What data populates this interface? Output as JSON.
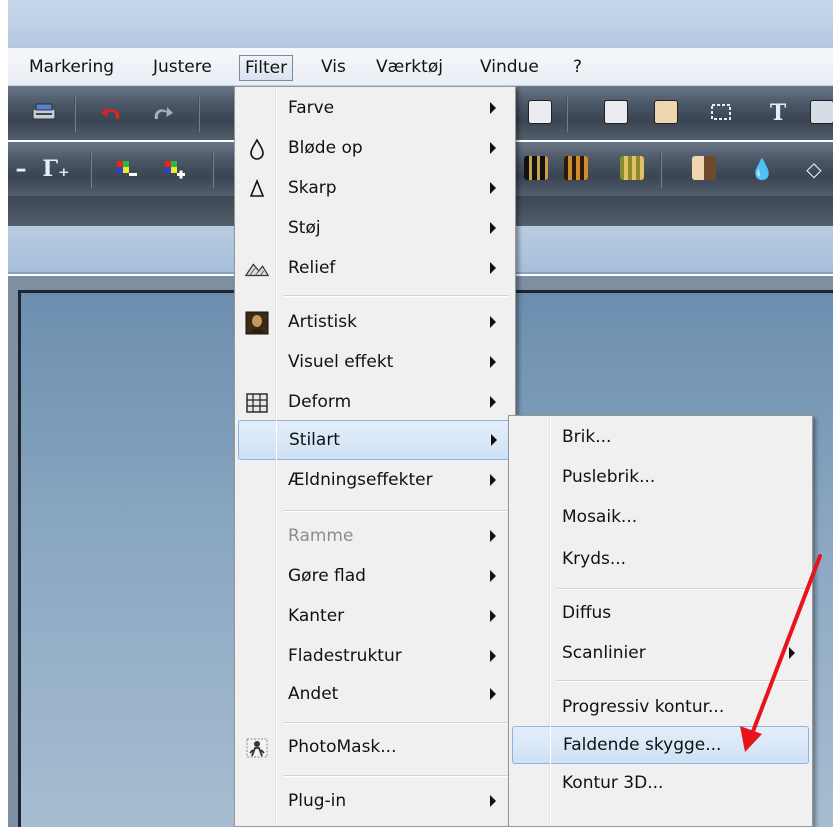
{
  "menubar": {
    "items": [
      "Markering",
      "Justere",
      "Filter",
      "Vis",
      "Værktøj",
      "Vindue",
      "?"
    ]
  },
  "filter_menu": {
    "items": [
      {
        "label": "Farve",
        "icon": "",
        "submenu": true
      },
      {
        "label": "Bløde op",
        "icon": "drop-outline-icon",
        "submenu": true
      },
      {
        "label": "Skarp",
        "icon": "triangle-outline-icon",
        "submenu": true
      },
      {
        "label": "Støj",
        "icon": "",
        "submenu": true
      },
      {
        "label": "Relief",
        "icon": "relief-icon",
        "submenu": true
      },
      {
        "label": "Artistisk",
        "icon": "mona-lisa-icon",
        "submenu": true
      },
      {
        "label": "Visuel effekt",
        "icon": "",
        "submenu": true
      },
      {
        "label": "Deform",
        "icon": "grid-icon",
        "submenu": true
      },
      {
        "label": "Stilart",
        "icon": "",
        "submenu": true,
        "highlighted": true
      },
      {
        "label": "Ældningseffekter",
        "icon": "",
        "submenu": true
      },
      {
        "label": "Ramme",
        "icon": "",
        "submenu": true,
        "disabled": true
      },
      {
        "label": "Gøre flad",
        "icon": "",
        "submenu": true
      },
      {
        "label": "Kanter",
        "icon": "",
        "submenu": true
      },
      {
        "label": "Fladestruktur",
        "icon": "",
        "submenu": true
      },
      {
        "label": "Andet",
        "icon": "",
        "submenu": true
      },
      {
        "label": "PhotoMask...",
        "icon": "photomask-icon",
        "submenu": false
      },
      {
        "label": "Plug-in",
        "icon": "",
        "submenu": true
      }
    ]
  },
  "stilart_submenu": {
    "items": [
      {
        "label": "Brik...",
        "submenu": false
      },
      {
        "label": "Puslebrik...",
        "submenu": false
      },
      {
        "label": "Mosaik...",
        "submenu": false
      },
      {
        "label": "Kryds...",
        "submenu": false
      },
      {
        "label": "Diffus",
        "submenu": false
      },
      {
        "label": "Scanlinier",
        "submenu": true
      },
      {
        "label": "Progressiv kontur...",
        "submenu": false
      },
      {
        "label": "Faldende skygge...",
        "submenu": false,
        "highlighted": true
      },
      {
        "label": "Kontur 3D...",
        "submenu": false
      }
    ]
  },
  "toolbar": {
    "row2_text": [
      "Γ₊"
    ],
    "text_tool_label": "T"
  },
  "colors": {
    "highlight": "#cfe1f5",
    "annotation_arrow": "#e8141c"
  }
}
